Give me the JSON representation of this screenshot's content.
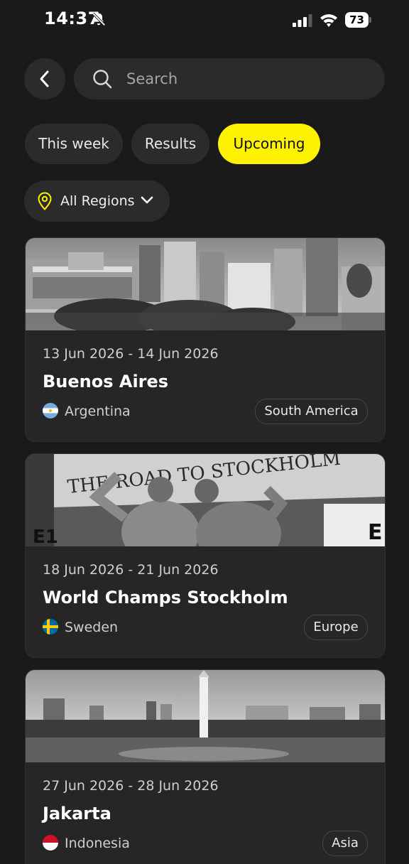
{
  "status_bar": {
    "time": "14:37",
    "battery": "73"
  },
  "header": {
    "search_placeholder": "Search"
  },
  "tabs": [
    {
      "label": "This week",
      "active": false
    },
    {
      "label": "Results",
      "active": false
    },
    {
      "label": "Upcoming",
      "active": true
    }
  ],
  "filter": {
    "region_label": "All Regions"
  },
  "events": [
    {
      "date": "13 Jun 2026 - 14 Jun 2026",
      "title": "Buenos Aires",
      "country": "Argentina",
      "region": "South America",
      "flag_icon": "argentina-flag-icon"
    },
    {
      "date": "18 Jun 2026 - 21 Jun 2026",
      "title": "World Champs Stockholm",
      "country": "Sweden",
      "region": "Europe",
      "flag_icon": "sweden-flag-icon"
    },
    {
      "date": "27 Jun 2026 - 28 Jun 2026",
      "title": "Jakarta",
      "country": "Indonesia",
      "region": "Asia",
      "flag_icon": "indonesia-flag-icon"
    }
  ],
  "colors": {
    "background": "#1a1a1a",
    "surface": "#2b2b2b",
    "card": "#262626",
    "accent": "#fff200"
  }
}
